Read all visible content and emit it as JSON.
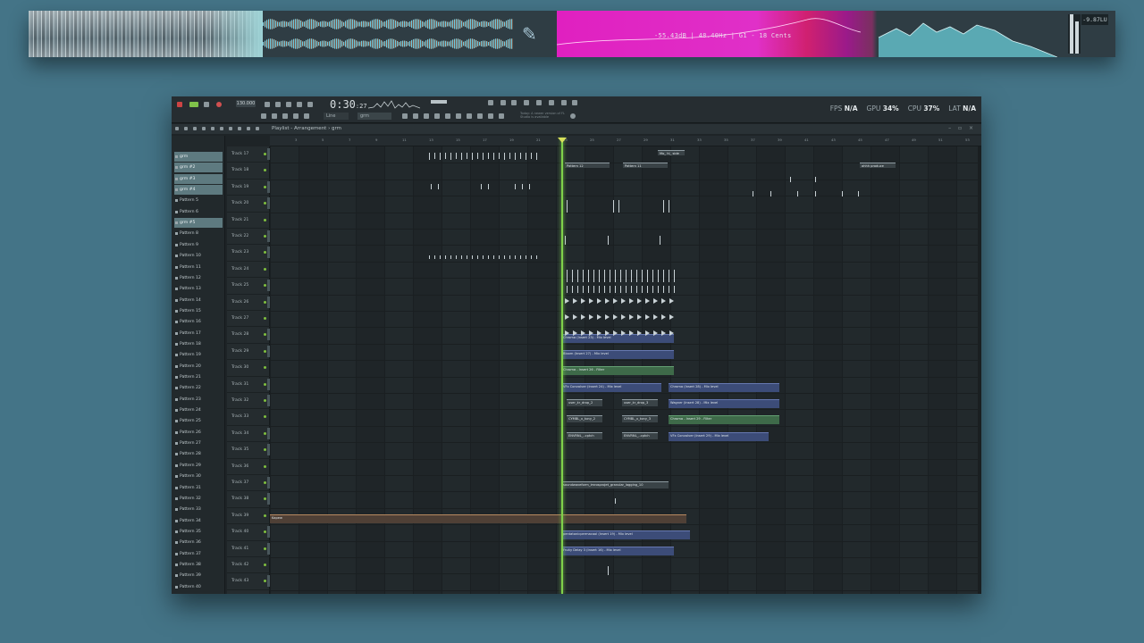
{
  "visualizer": {
    "spectrum_readout": "-55.43dB | 48.40Hz | G1 - 18 Cents",
    "lufs_readout": "-9.87LU"
  },
  "toolbar": {
    "bpm": "130.000",
    "time_main": "0:30",
    "time_sub": ":27",
    "snap": "Line",
    "pattern": "grm",
    "hint": "Today: A newer version of FL Studio is available",
    "stats": {
      "fps_label": "FPS",
      "fps_value": "N/A",
      "gpu_label": "GPU",
      "gpu_value": "34%",
      "cpu_label": "CPU",
      "cpu_value": "37%",
      "lat_label": "LAT",
      "lat_value": "N/A"
    }
  },
  "window": {
    "title": "Playlist - Arrangement › grm",
    "controls": "– ▫ ×"
  },
  "ruler": [
    "3",
    "5",
    "7",
    "9",
    "11",
    "13",
    "15",
    "17",
    "19",
    "21",
    "23",
    "25",
    "27",
    "29",
    "31",
    "33",
    "35",
    "37",
    "39",
    "41",
    "43",
    "45",
    "47",
    "49",
    "51",
    "53"
  ],
  "patterns": [
    {
      "name": "grm",
      "selected": true
    },
    {
      "name": "grm #2",
      "selected": true
    },
    {
      "name": "grm #3",
      "selected": true
    },
    {
      "name": "grm #4",
      "selected": true
    },
    {
      "name": "Pattern 5",
      "selected": false
    },
    {
      "name": "Pattern 6",
      "selected": false
    },
    {
      "name": "grm #5",
      "selected": true
    },
    {
      "name": "Pattern 8",
      "selected": false
    },
    {
      "name": "Pattern 9",
      "selected": false
    },
    {
      "name": "Pattern 10",
      "selected": false
    },
    {
      "name": "Pattern 11",
      "selected": false
    },
    {
      "name": "Pattern 12",
      "selected": false
    },
    {
      "name": "Pattern 13",
      "selected": false
    },
    {
      "name": "Pattern 14",
      "selected": false
    },
    {
      "name": "Pattern 15",
      "selected": false
    },
    {
      "name": "Pattern 16",
      "selected": false
    },
    {
      "name": "Pattern 17",
      "selected": false
    },
    {
      "name": "Pattern 18",
      "selected": false
    },
    {
      "name": "Pattern 19",
      "selected": false
    },
    {
      "name": "Pattern 20",
      "selected": false
    },
    {
      "name": "Pattern 21",
      "selected": false
    },
    {
      "name": "Pattern 22",
      "selected": false
    },
    {
      "name": "Pattern 23",
      "selected": false
    },
    {
      "name": "Pattern 24",
      "selected": false
    },
    {
      "name": "Pattern 25",
      "selected": false
    },
    {
      "name": "Pattern 26",
      "selected": false
    },
    {
      "name": "Pattern 27",
      "selected": false
    },
    {
      "name": "Pattern 28",
      "selected": false
    },
    {
      "name": "Pattern 29",
      "selected": false
    },
    {
      "name": "Pattern 30",
      "selected": false
    },
    {
      "name": "Pattern 31",
      "selected": false
    },
    {
      "name": "Pattern 32",
      "selected": false
    },
    {
      "name": "Pattern 33",
      "selected": false
    },
    {
      "name": "Pattern 34",
      "selected": false
    },
    {
      "name": "Pattern 35",
      "selected": false
    },
    {
      "name": "Pattern 36",
      "selected": false
    },
    {
      "name": "Pattern 37",
      "selected": false
    },
    {
      "name": "Pattern 38",
      "selected": false
    },
    {
      "name": "Pattern 39",
      "selected": false
    },
    {
      "name": "Pattern 40",
      "selected": false
    }
  ],
  "tracks": [
    "Track 17",
    "Track 18",
    "Track 19",
    "Track 20",
    "Track 21",
    "Track 22",
    "Track 23",
    "Track 24",
    "Track 25",
    "Track 26",
    "Track 27",
    "Track 28",
    "Track 29",
    "Track 30",
    "Track 31",
    "Track 32",
    "Track 33",
    "Track 34",
    "Track 35",
    "Track 36",
    "Track 37",
    "Track 38",
    "Track 39",
    "Track 40",
    "Track 41",
    "Track 42",
    "Track 43"
  ],
  "clips": [
    {
      "label": "Mo_ hi_ side",
      "color": "ghost"
    },
    {
      "label": "Pattern 12",
      "color": "ghost"
    },
    {
      "label": "Pattern 11",
      "color": "ghost"
    },
    {
      "label": "ahhh produce",
      "color": "ghost"
    },
    {
      "label": "Chroma (Insert 23) - Mix level",
      "color": "blue"
    },
    {
      "label": "Bloom (Insert 27) - Mix level",
      "color": "blue"
    },
    {
      "label": "Chroma - Insert 26 - Filter",
      "color": "green"
    },
    {
      "label": "VFx Convolver (Insert 24) - Mix level",
      "color": "blue"
    },
    {
      "label": "Chroma (Insert 28) - Mix level",
      "color": "blue"
    },
    {
      "label": "Wagner (Insert 28) - Mix level",
      "color": "blue"
    },
    {
      "label": "Chroma - Insert 29 - Filter",
      "color": "green"
    },
    {
      "label": "VFx Convolver (Insert 29) - Mix level",
      "color": "blue"
    },
    {
      "label": "user_kr_drop_2",
      "color": "ghost"
    },
    {
      "label": "user_kr_drop_3",
      "color": "ghost"
    },
    {
      "label": "CYMBL_x_tony_2",
      "color": "ghost"
    },
    {
      "label": "CYMBL_x_tony_3",
      "color": "ghost"
    },
    {
      "label": "ENVRNL_..cptch",
      "color": "ghost"
    },
    {
      "label": "ENVRNL_..cptch",
      "color": "ghost"
    },
    {
      "label": "soundwaveform_imrosprojet_granular_lagging_10",
      "color": "ghost"
    },
    {
      "label": "Kapew",
      "color": "orange"
    },
    {
      "label": "pentatonicpermacool (Insert 19) - Mix level",
      "color": "blue"
    },
    {
      "label": "Fruity Delay 3 (Insert 16) - Mix level",
      "color": "blue"
    }
  ]
}
